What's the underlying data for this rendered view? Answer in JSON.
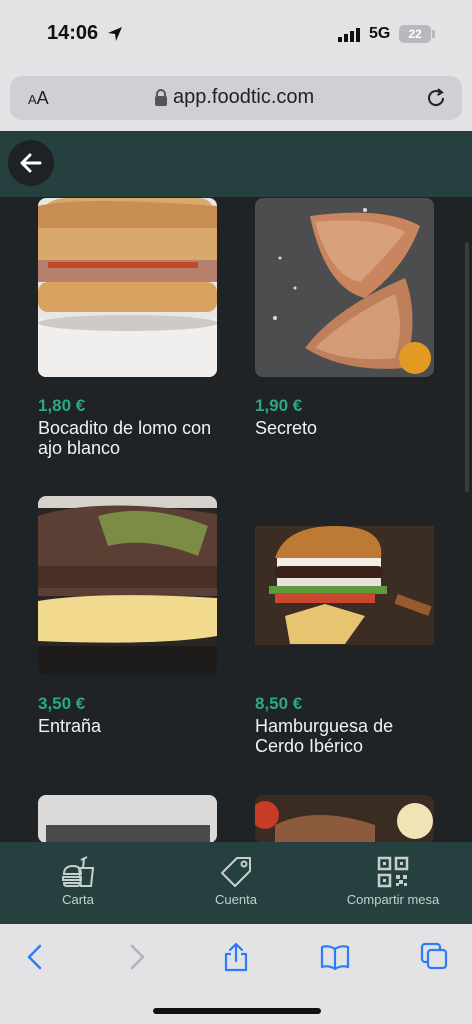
{
  "status": {
    "time": "14:06",
    "network": "5G",
    "battery": "22"
  },
  "browser": {
    "aa_small": "A",
    "aa_large": "A",
    "url": "app.foodtic.com"
  },
  "products": [
    {
      "price": "1,80 €",
      "name": "Bocadito de lomo con ajo blanco"
    },
    {
      "price": "1,90 €",
      "name": "Secreto"
    },
    {
      "price": "3,50 €",
      "name": "Entraña"
    },
    {
      "price": "8,50 €",
      "name": "Hamburguesa de Cerdo Ibérico"
    }
  ],
  "tabs": [
    {
      "label": "Carta"
    },
    {
      "label": "Cuenta"
    },
    {
      "label": "Compartir mesa"
    }
  ],
  "colors": {
    "accent": "#2aa886",
    "header": "#25403f",
    "background": "#202326"
  }
}
